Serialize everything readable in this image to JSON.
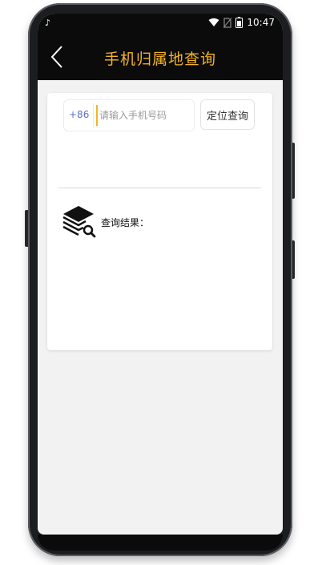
{
  "status_bar": {
    "tiktok_glyph": "♪",
    "time": "10:47",
    "icons": [
      "wifi-icon",
      "no-sim-icon",
      "battery-icon"
    ]
  },
  "app_bar": {
    "title": "手机归属地查询",
    "back_icon": "chevron-left-icon"
  },
  "search": {
    "country_code": "+86",
    "placeholder": "请输入手机号码",
    "value": "",
    "button_label": "定位查询"
  },
  "result": {
    "label": "查询结果：",
    "icon": "books-search-icon"
  },
  "colors": {
    "title": "#f5b325",
    "country_code": "#5b6fd1",
    "app_bar": "#0b0b0b",
    "background": "#f2f2f2"
  }
}
